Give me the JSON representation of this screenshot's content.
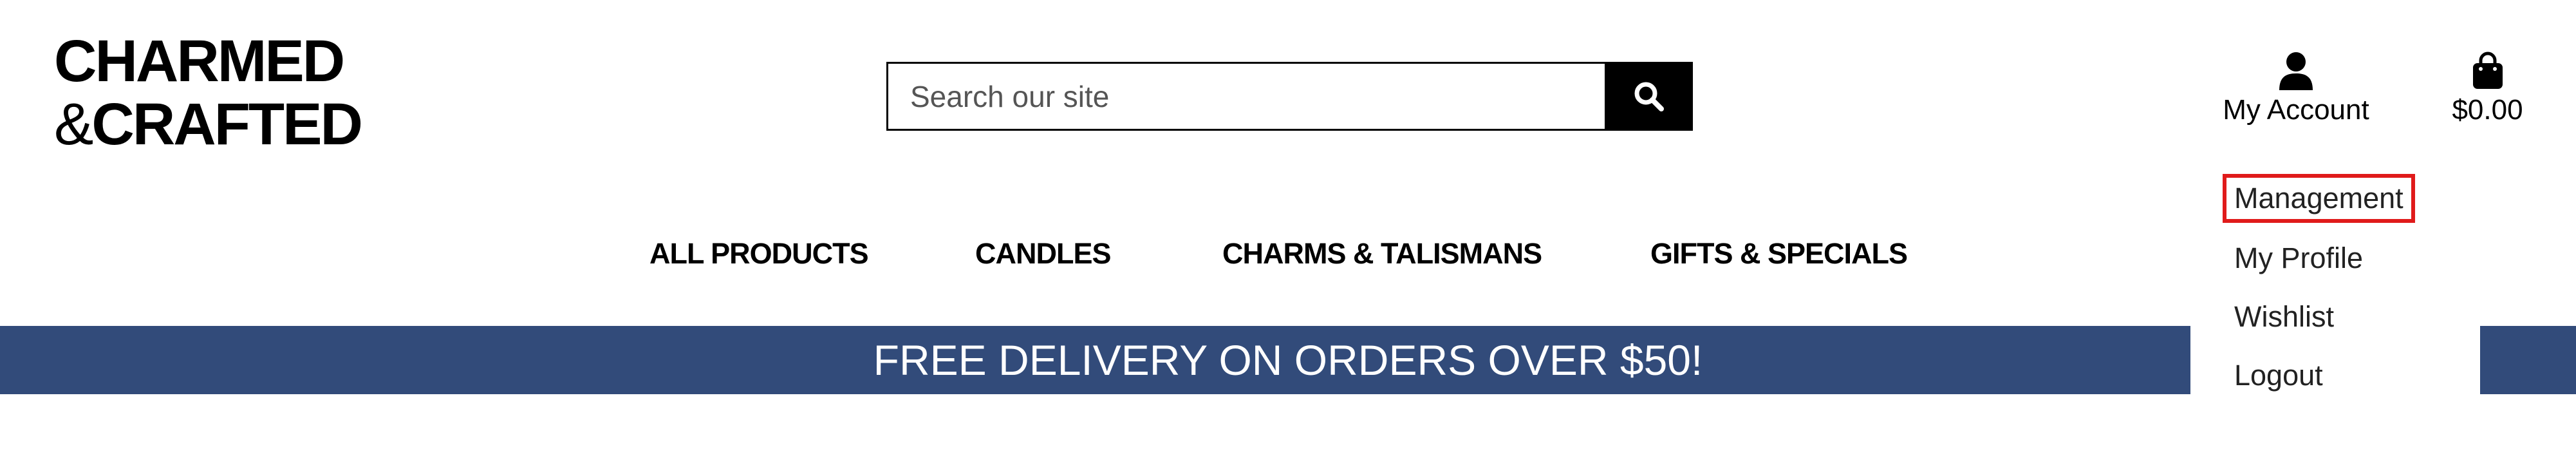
{
  "brand": {
    "line1": "CHARMED",
    "line2_amp": "&",
    "line2_rest": "CRAFTED"
  },
  "search": {
    "placeholder": "Search our site",
    "value": ""
  },
  "account": {
    "label": "My Account",
    "icon": "user-icon"
  },
  "bag": {
    "total": "$0.00",
    "icon": "shopping-bag-icon"
  },
  "nav": {
    "items": [
      {
        "label": "ALL PRODUCTS"
      },
      {
        "label": "CANDLES"
      },
      {
        "label": "CHARMS & TALISMANS"
      },
      {
        "label": "GIFTS & SPECIALS"
      }
    ]
  },
  "banner": {
    "text": "FREE DELIVERY ON ORDERS OVER $50!",
    "color": "#324b7a"
  },
  "account_menu": {
    "items": [
      {
        "label": "Management"
      },
      {
        "label": "My Profile"
      },
      {
        "label": "Wishlist"
      },
      {
        "label": "Logout"
      }
    ],
    "highlight_color": "#e01b1b"
  }
}
